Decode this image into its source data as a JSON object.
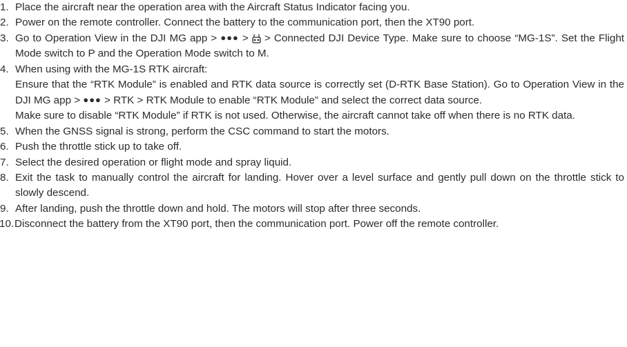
{
  "steps": [
    {
      "num": "1.",
      "text": "Place the aircraft near the operation area with the Aircraft Status Indicator facing you."
    },
    {
      "num": "2.",
      "text": "Power on the remote controller. Connect the battery to the communication port, then the XT90 port."
    },
    {
      "num": "3.",
      "text_a": "Go to Operation View in the DJI MG app > ",
      "text_b": " > ",
      "text_c": " > Connected DJI Device Type. Make sure to choose “MG-1S”. Set the Flight Mode switch to P and the Operation Mode switch to M."
    },
    {
      "num": "4.",
      "line1": "When using with the MG-1S RTK aircraft:",
      "para1_a": "Ensure that the “RTK Module” is enabled and RTK data source is correctly set (D-RTK Base Station). Go to Operation View in the DJI MG app > ",
      "para1_b": " > RTK > RTK Module to enable “RTK Module” and select the correct data source.",
      "para2": "Make sure to disable “RTK Module” if RTK is not used. Otherwise, the aircraft cannot take off when there is no RTK data."
    },
    {
      "num": "5.",
      "text": "When the GNSS signal is strong, perform the CSC command to start the motors."
    },
    {
      "num": "6.",
      "text": "Push the throttle stick up to take off."
    },
    {
      "num": "7.",
      "text": "Select the desired operation or flight mode and spray liquid."
    },
    {
      "num": "8.",
      "text": "Exit the task to manually control the aircraft for landing. Hover over a level surface and gently pull down on the throttle stick to slowly descend."
    },
    {
      "num": "9.",
      "text": "After landing, push the throttle down and hold. The motors will stop after three seconds."
    },
    {
      "num": "10.",
      "text": "Disconnect the battery from the XT90 port, then the communication port. Power off the remote controller."
    }
  ],
  "icons": {
    "more": "more-dots-icon",
    "rc": "remote-controller-icon"
  },
  "colors": {
    "text": "#2b2b2b"
  }
}
